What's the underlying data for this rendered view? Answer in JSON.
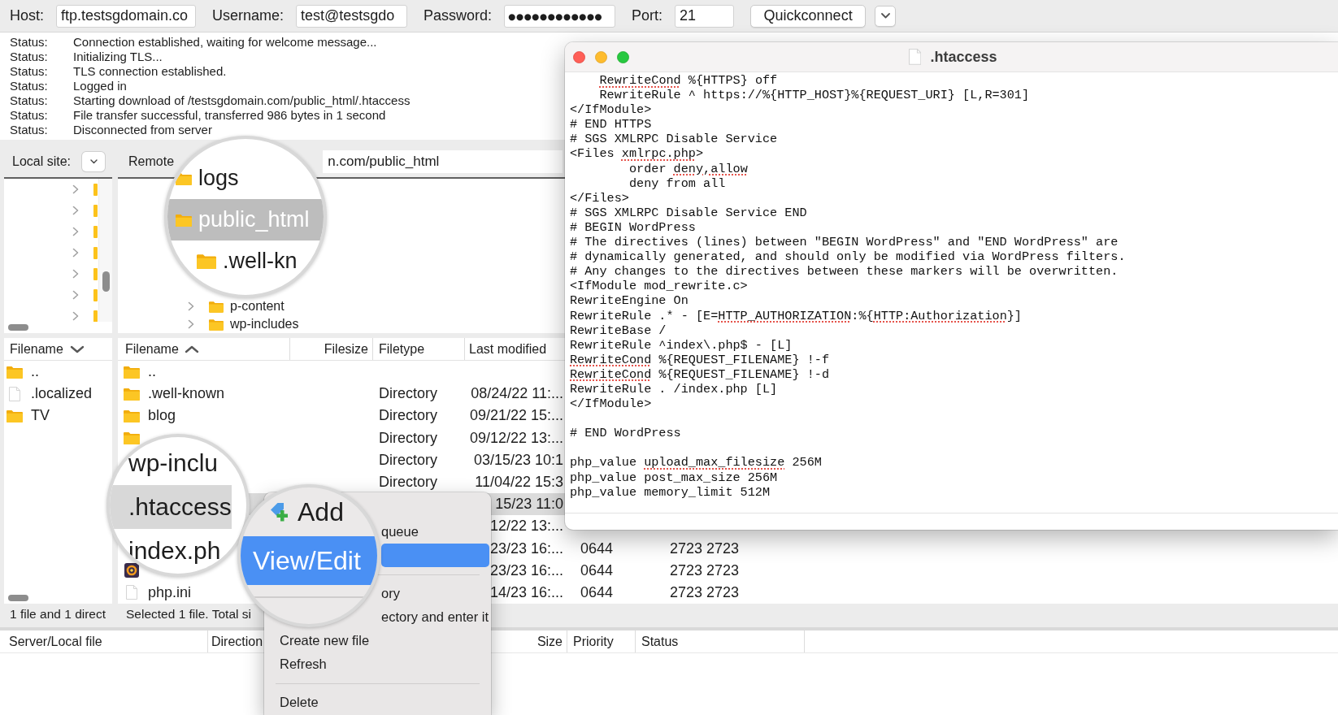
{
  "quickconnect_bar": {
    "fields": [
      {
        "kind": "text",
        "label": "Host:",
        "value": "ftp.testsgdomain.co"
      },
      {
        "kind": "text",
        "label": "Username:",
        "value": "test@testsgdo"
      },
      {
        "kind": "password",
        "label": "Password:",
        "value": "●●●●●●●●●●●●"
      },
      {
        "kind": "text",
        "label": "Port:",
        "value": "21"
      }
    ],
    "button": "Quickconnect"
  },
  "message_log": [
    {
      "label": "Status:",
      "message": "Connection established, waiting for welcome message..."
    },
    {
      "label": "Status:",
      "message": "Initializing TLS..."
    },
    {
      "label": "Status:",
      "message": "TLS connection established."
    },
    {
      "label": "Status:",
      "message": "Logged in"
    },
    {
      "label": "Status:",
      "message": "Starting download of /testsgdomain.com/public_html/.htaccess"
    },
    {
      "label": "Status:",
      "message": "File transfer successful, transferred 986 bytes in 1 second"
    },
    {
      "label": "Status:",
      "message": "Disconnected from server"
    }
  ],
  "local_site": {
    "label": "Local site:",
    "tree": [
      {
        "expanded": false
      },
      {
        "expanded": false
      },
      {
        "expanded": false
      },
      {
        "expanded": false
      },
      {
        "expanded": false
      },
      {
        "expanded": false
      },
      {
        "expanded": false
      }
    ],
    "file_list": {
      "columns": [
        {
          "label": "Filename",
          "ascending": false
        }
      ],
      "rows": [
        {
          "kind": "folder",
          "name": "..",
          "selected": false
        },
        {
          "kind": "file",
          "name": ".localized",
          "selected": false
        },
        {
          "kind": "folder",
          "name": "TV",
          "selected": false
        }
      ]
    },
    "status": "1 file and 1 direct"
  },
  "remote_site": {
    "label": "Remote",
    "path": "n.com/public_html",
    "tree": [
      {
        "label": "p-content",
        "expanded": false
      },
      {
        "label": "wp-includes",
        "expanded": false
      }
    ],
    "file_list": {
      "columns": [
        {
          "label": "Filename",
          "ascending": true
        },
        {
          "label": "Filesize"
        },
        {
          "label": "Filetype"
        },
        {
          "label": "Last modified"
        }
      ],
      "rows": [
        {
          "kind": "folder",
          "name": "..",
          "selected": false
        },
        {
          "kind": "folder",
          "name": ".well-known",
          "filetype": "Directory",
          "last_modified": "08/24/22 11:...",
          "selected": false
        },
        {
          "kind": "folder",
          "name": "blog",
          "filetype": "Directory",
          "last_modified": "09/21/22 15:...",
          "selected": false
        },
        {
          "kind": "folder",
          "filetype": "Directory",
          "last_modified": "09/12/22 13:...",
          "selected": false
        },
        {
          "filetype": "Directory",
          "last_modified": "03/15/23 10:1",
          "selected": false
        },
        {
          "filetype": "Directory",
          "last_modified": "11/04/22 15:3",
          "selected": false
        },
        {
          "last_modified": "15/23 11:0",
          "selected": true
        },
        {
          "last_modified": "12/22 13:...",
          "selected": false
        },
        {
          "last_modified": "23/23 16:...",
          "permissions": "0644",
          "owner_group": "2723 2723",
          "selected": false
        },
        {
          "kind": "script",
          "last_modified": "23/23 16:...",
          "permissions": "0644",
          "owner_group": "2723 2723",
          "selected": false
        },
        {
          "kind": "file",
          "name": "php.ini",
          "last_modified": "14/23 16:...",
          "permissions": "0644",
          "owner_group": "2723 2723",
          "selected": false
        }
      ]
    },
    "status": "Selected 1 file. Total si"
  },
  "transfer_queue": {
    "columns": [
      "Server/Local file",
      "Direction",
      "Size",
      "Priority",
      "Status"
    ]
  },
  "editor": {
    "title": ".htaccess",
    "blocks": [
      [
        [
          {
            "text": "    RewriteCond",
            "misspelled": true
          },
          {
            "text": " %{HTTPS} off",
            "misspelled": false
          }
        ],
        [
          {
            "text": "    RewriteRule ^ https://%{HTTP_HOST}%{REQUEST_URI} [L,R=301]",
            "misspelled": false
          }
        ],
        [
          {
            "text": "</IfModule>",
            "misspelled": false
          }
        ],
        [
          {
            "text": "# END HTTPS",
            "misspelled": false
          }
        ],
        [
          {
            "text": "# SGS XMLRPC Disable Service",
            "misspelled": false
          }
        ],
        [
          {
            "text": "<Files ",
            "misspelled": false
          },
          {
            "text": "xmlrpc.php",
            "misspelled": true
          },
          {
            "text": ">",
            "misspelled": false
          }
        ],
        [
          {
            "text": "        order ",
            "misspelled": false
          },
          {
            "text": "deny,allow",
            "misspelled": true
          }
        ],
        [
          {
            "text": "        deny from all",
            "misspelled": false
          }
        ],
        [
          {
            "text": "</Files>",
            "misspelled": false
          }
        ],
        [
          {
            "text": "# SGS XMLRPC Disable Service END",
            "misspelled": false
          }
        ],
        [
          {
            "text": "# BEGIN WordPress",
            "misspelled": false
          }
        ],
        [
          {
            "text": "# The directives (lines) between \"BEGIN WordPress\" and \"END WordPress\" are",
            "misspelled": false
          }
        ],
        [
          {
            "text": "# dynamically generated, and should only be modified via WordPress filters.",
            "misspelled": false
          }
        ],
        [
          {
            "text": "# Any changes to the directives between these markers will be overwritten.",
            "misspelled": false
          }
        ],
        [
          {
            "text": "<IfModule mod_rewrite.c>",
            "misspelled": false
          }
        ],
        [
          {
            "text": "RewriteEngine On",
            "misspelled": false
          }
        ],
        [
          {
            "text": "RewriteRule .* - [E=",
            "misspelled": false
          },
          {
            "text": "HTTP_AUTHORIZATION",
            "misspelled": true
          },
          {
            "text": ":%{",
            "misspelled": false
          },
          {
            "text": "HTTP:Authorization",
            "misspelled": true
          },
          {
            "text": "}]",
            "misspelled": false
          }
        ],
        [
          {
            "text": "RewriteBase /",
            "misspelled": false
          }
        ],
        [
          {
            "text": "RewriteRule ^index\\.php$ - [L]",
            "misspelled": false
          }
        ],
        [
          {
            "text": "RewriteCond",
            "misspelled": true
          },
          {
            "text": " %{REQUEST_FILENAME} !-f",
            "misspelled": false
          }
        ],
        [
          {
            "text": "RewriteCond",
            "misspelled": true
          },
          {
            "text": " %{REQUEST_FILENAME} !-d",
            "misspelled": false
          }
        ],
        [
          {
            "text": "RewriteRule . /index.php [L]",
            "misspelled": false
          }
        ],
        [
          {
            "text": "</IfModule>",
            "misspelled": false
          }
        ]
      ],
      [
        [
          {
            "text": "# END WordPress",
            "misspelled": false
          }
        ]
      ],
      [
        [
          {
            "text": "php_value ",
            "misspelled": false
          },
          {
            "text": "upload_max_filesize",
            "misspelled": true
          },
          {
            "text": " 256M",
            "misspelled": false
          }
        ],
        [
          {
            "text": "php_value post_max_size 256M",
            "misspelled": false
          }
        ],
        [
          {
            "text": "php_value memory_limit 512M",
            "misspelled": false
          }
        ]
      ]
    ]
  },
  "context_menu": {
    "items": [
      {
        "kind": "item",
        "label": "queue",
        "selected": false
      },
      {
        "kind": "item",
        "selected": true
      },
      {
        "kind": "separator"
      },
      {
        "kind": "item",
        "label": "ory",
        "selected": false
      },
      {
        "kind": "item",
        "label": "ectory and enter it",
        "selected": false
      },
      {
        "kind": "item",
        "label": "Create new file",
        "selected": false
      },
      {
        "kind": "item",
        "label": "Refresh",
        "selected": false
      },
      {
        "kind": "separator"
      },
      {
        "kind": "item",
        "label": "Delete",
        "selected": false
      }
    ]
  },
  "magnifiers": [
    {
      "rows": [
        {
          "kind": "folder",
          "label": "logs",
          "selected": false
        },
        {
          "kind": "folder",
          "label": "public_html",
          "selected": true,
          "children": [
            {
              "kind": "folder",
              "label": ".well-kn",
              "selected": false
            }
          ]
        }
      ]
    },
    {
      "rows": [
        {
          "label": "wp-inclu",
          "selected": false
        },
        {
          "label": ".htaccess",
          "selected": true
        },
        {
          "label": "index.ph",
          "selected": false
        }
      ]
    },
    {
      "rows": [
        {
          "kind": "queue",
          "label": "Add",
          "selected": false
        },
        {
          "label": "View/Edit",
          "selected": true
        },
        {
          "kind": "separator"
        }
      ]
    }
  ]
}
